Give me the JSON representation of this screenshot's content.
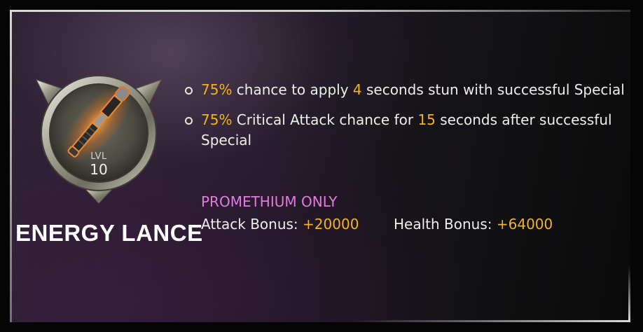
{
  "item": {
    "name": "ENERGY LANCE",
    "level_label": "LVL",
    "level_value": "10",
    "icon": "energy-lance-baton-icon"
  },
  "effects": [
    {
      "parts": [
        {
          "text": "75%",
          "hl": true
        },
        {
          "text": " chance to apply ",
          "hl": false
        },
        {
          "text": "4",
          "hl": true
        },
        {
          "text": " seconds stun with successful Special",
          "hl": false
        }
      ]
    },
    {
      "parts": [
        {
          "text": "75%",
          "hl": true
        },
        {
          "text": " Critical Attack chance for ",
          "hl": false
        },
        {
          "text": "15",
          "hl": true
        },
        {
          "text": " seconds after successful Special",
          "hl": false
        }
      ]
    }
  ],
  "promethium": {
    "title": "PROMETHIUM ONLY",
    "attack_label": "Attack Bonus: ",
    "attack_value": "+20000",
    "health_label": "Health Bonus: ",
    "health_value": "+64000"
  },
  "colors": {
    "highlight": "#f3b21f",
    "promethium": "#e27ae0",
    "text": "#f0eee9"
  }
}
